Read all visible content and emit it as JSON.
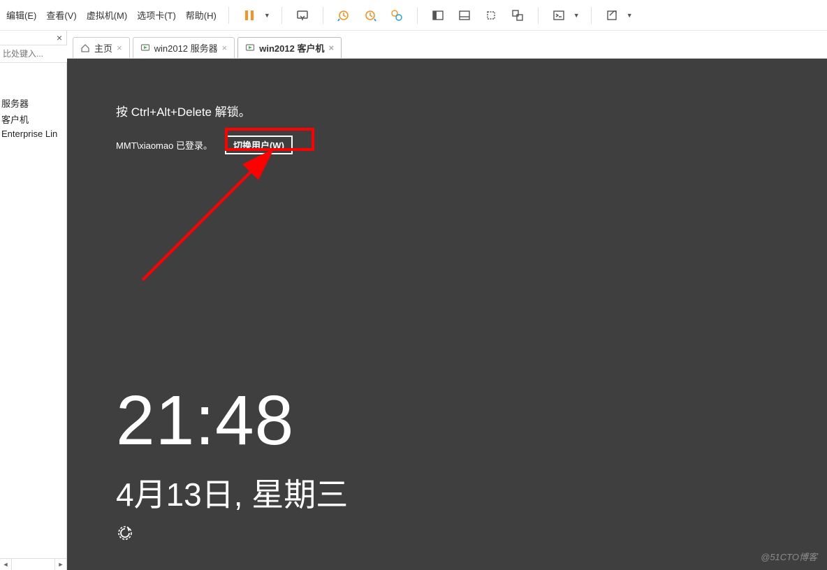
{
  "menubar": {
    "items": [
      "编辑(E)",
      "查看(V)",
      "虚拟机(M)",
      "选项卡(T)",
      "帮助(H)"
    ]
  },
  "sidebar": {
    "search_placeholder": "比处键入...",
    "tree": [
      "服务器",
      "客户机",
      "Enterprise Lin"
    ]
  },
  "tabs": [
    {
      "label": "主页",
      "active": false,
      "icon": "home"
    },
    {
      "label": "win2012 服务器",
      "active": false,
      "icon": "vm"
    },
    {
      "label": "win2012 客户机",
      "active": true,
      "icon": "vm"
    }
  ],
  "lock": {
    "ctrl_alt_del": "按 Ctrl+Alt+Delete 解锁。",
    "logged_in": "MMT\\xiaomao 已登录。",
    "switch_user": "切换用户(W)",
    "time": "21:48",
    "date": "4月13日, 星期三"
  },
  "watermark": "@51CTO博客"
}
